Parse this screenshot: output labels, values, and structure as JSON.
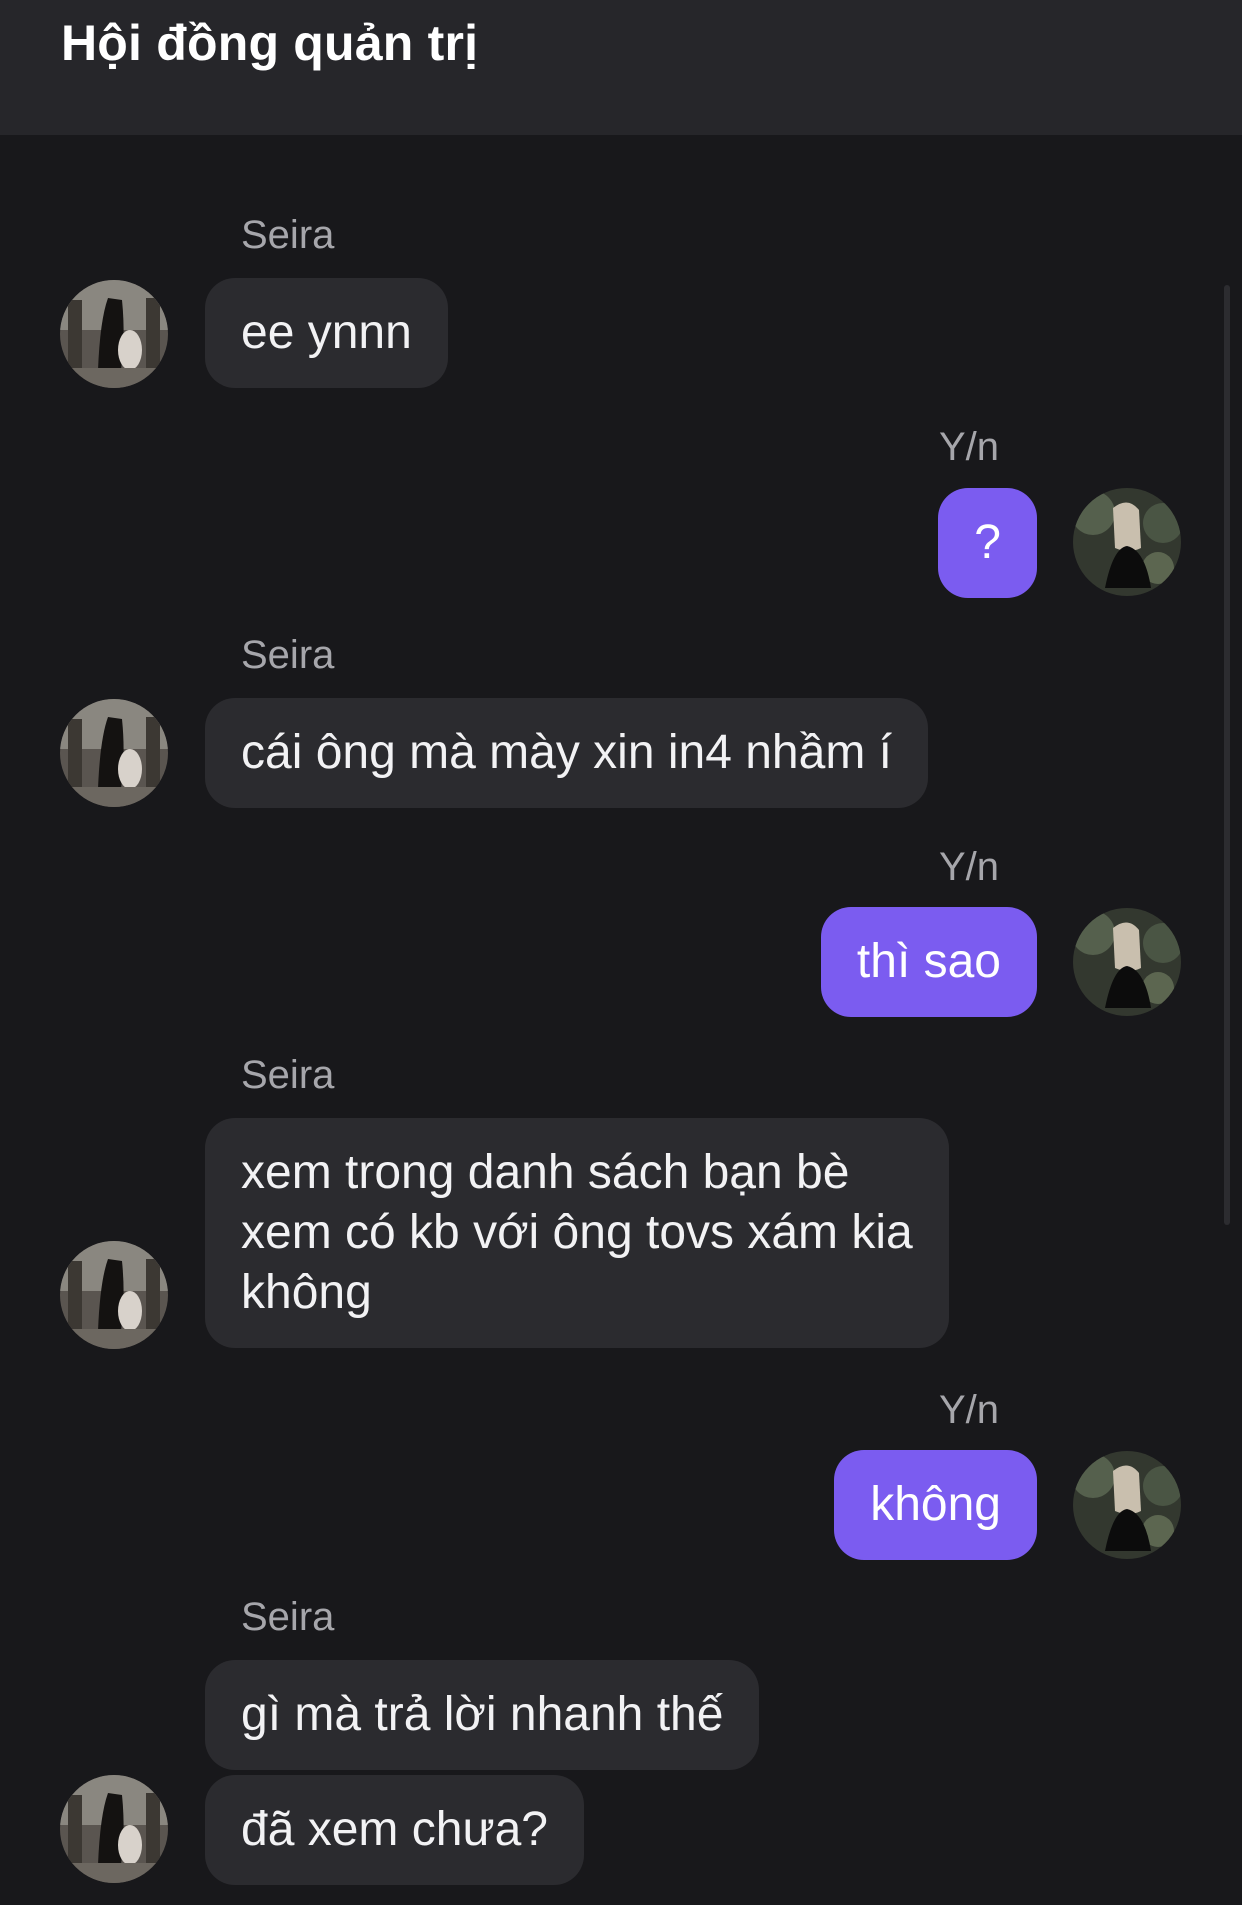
{
  "header": {
    "title": "Hội đồng quản trị"
  },
  "colors": {
    "background": "#18181b",
    "header": "#26262a",
    "incoming_bubble": "#2b2b2f",
    "outgoing_bubble": "#7b5cf0",
    "sender_name": "#a6a6ab"
  },
  "messages": [
    {
      "sender": "Seira",
      "side": "left",
      "text": "ee ynnn"
    },
    {
      "sender": "Y/n",
      "side": "right",
      "text": "?"
    },
    {
      "sender": "Seira",
      "side": "left",
      "text": "cái ông mà mày xin in4 nhầm í"
    },
    {
      "sender": "Y/n",
      "side": "right",
      "text": "thì sao"
    },
    {
      "sender": "Seira",
      "side": "left",
      "text": "xem trong danh sách bạn bè\nxem có kb với ông tovs xám kia\nkhông"
    },
    {
      "sender": "Y/n",
      "side": "right",
      "text": "không"
    },
    {
      "sender": "Seira",
      "side": "left",
      "text": "gì mà trả lời nhanh thế"
    },
    {
      "sender": "Seira",
      "side": "left",
      "text": "đã xem chưa?"
    }
  ]
}
